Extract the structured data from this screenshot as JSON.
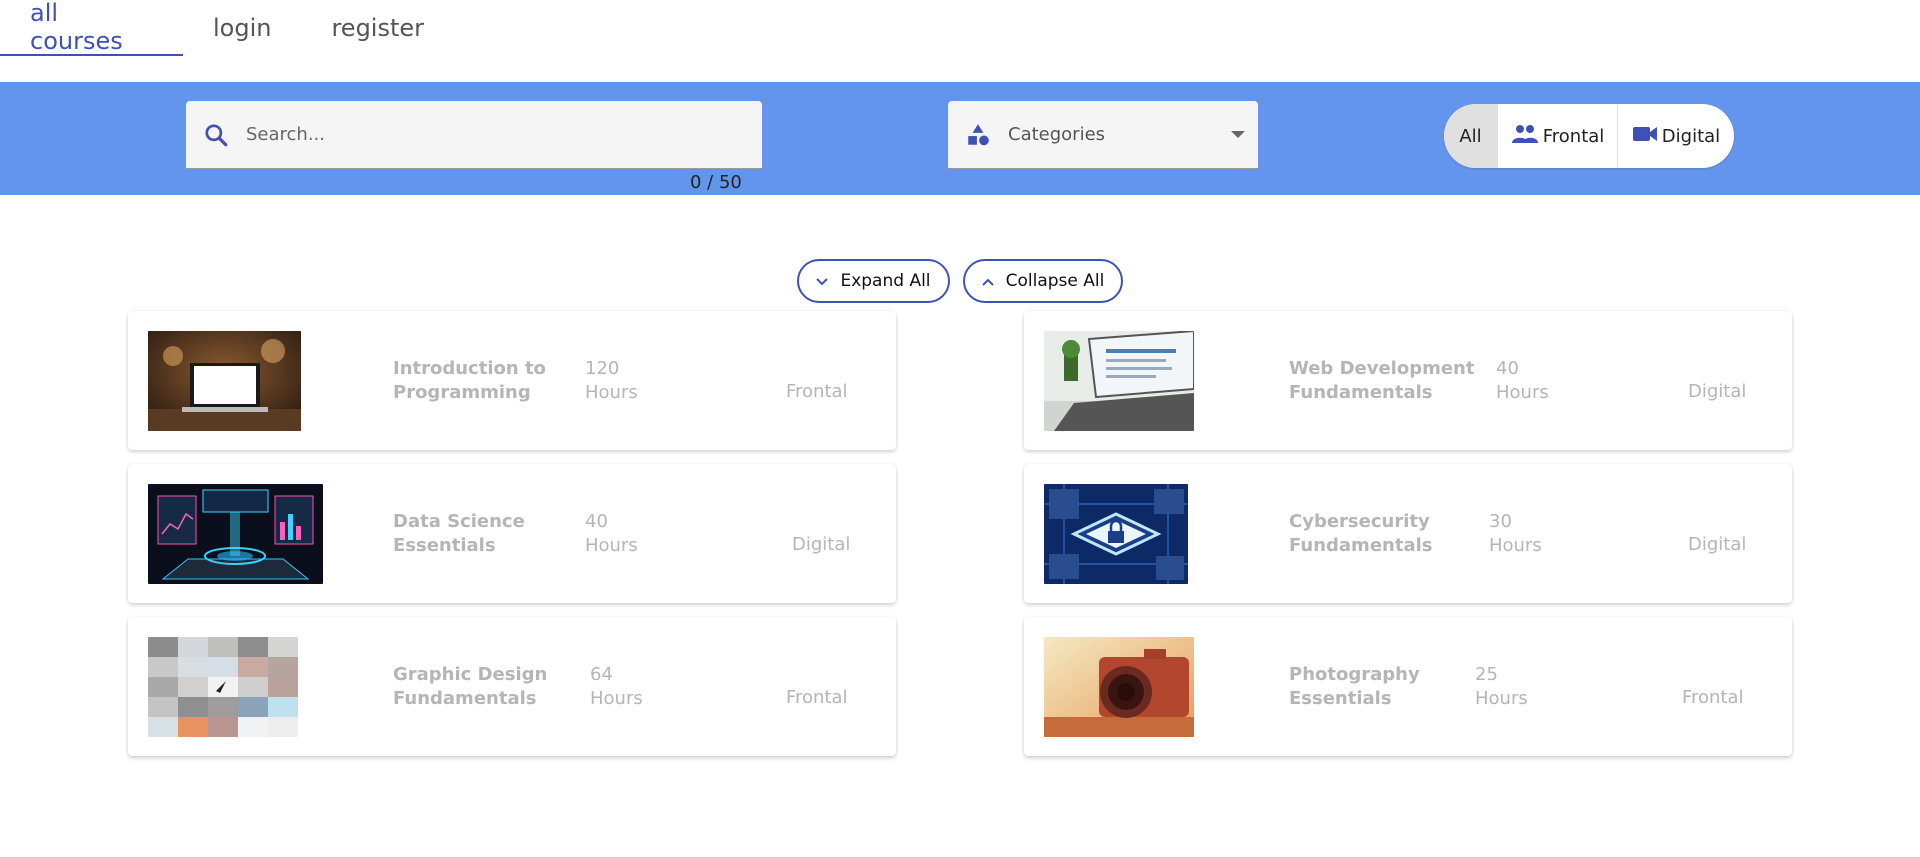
{
  "nav": {
    "tabs": [
      {
        "label": "all courses",
        "active": true
      },
      {
        "label": "login",
        "active": false
      },
      {
        "label": "register",
        "active": false
      }
    ]
  },
  "filters": {
    "search_placeholder": "Search...",
    "counter": "0 / 50",
    "categories_label": "Categories",
    "toggles": [
      {
        "label": "All",
        "icon": "none",
        "selected": true
      },
      {
        "label": "Frontal",
        "icon": "people-icon",
        "selected": false
      },
      {
        "label": "Digital",
        "icon": "videocam-icon",
        "selected": false
      }
    ]
  },
  "actions": {
    "expand_all": "Expand All",
    "collapse_all": "Collapse All"
  },
  "courses": [
    {
      "title_1": "Introduction to",
      "title_2": "Programming",
      "hours_value": "120",
      "hours_unit": "Hours",
      "mode": "Frontal",
      "image": "laptop-on-table"
    },
    {
      "title_1": "Web Development",
      "title_2": "Fundamentals",
      "hours_value": "40",
      "hours_unit": "Hours",
      "mode": "Digital",
      "image": "laptop-code-screen"
    },
    {
      "title_1": "Data Science",
      "title_2": "Essentials",
      "hours_value": "40",
      "hours_unit": "Hours",
      "mode": "Digital",
      "image": "holographic-dashboard"
    },
    {
      "title_1": "Cybersecurity",
      "title_2": "Fundamentals",
      "hours_value": "30",
      "hours_unit": "Hours",
      "mode": "Digital",
      "image": "padlock-circuit"
    },
    {
      "title_1": "Graphic Design",
      "title_2": "Fundamentals",
      "hours_value": "64",
      "hours_unit": "Hours",
      "mode": "Frontal",
      "image": "pixel-mosaic"
    },
    {
      "title_1": "Photography",
      "title_2": "Essentials",
      "hours_value": "25",
      "hours_unit": "Hours",
      "mode": "Frontal",
      "image": "camera-lens"
    }
  ],
  "colors": {
    "accent": "#3f51b5",
    "filter_bar": "#6495ed",
    "muted_text": "#b5b5b5"
  }
}
